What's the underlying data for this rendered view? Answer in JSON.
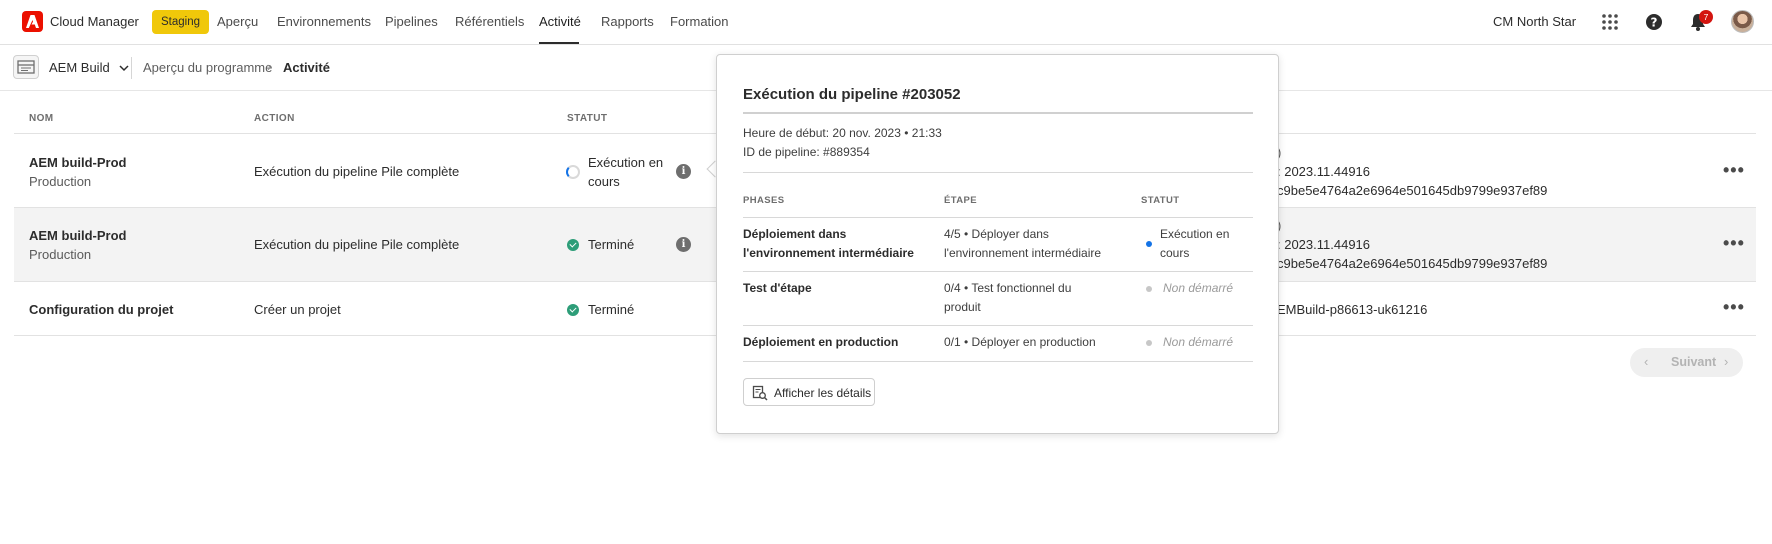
{
  "topnav": {
    "app_title": "Cloud Manager",
    "env_badge": "Staging",
    "items": [
      "Aperçu",
      "Environnements",
      "Pipelines",
      "Référentiels",
      "Activité",
      "Rapports",
      "Formation"
    ],
    "active_index": 4,
    "org_name": "CM North Star",
    "notification_count": "7"
  },
  "subheader": {
    "program_name": "AEM Build",
    "breadcrumb": [
      "Aperçu du programme",
      "Activité"
    ]
  },
  "table": {
    "columns": [
      "NOM",
      "ACTION",
      "STATUT"
    ],
    "rows": [
      {
        "name": "AEM build-Prod",
        "sub": "Production",
        "action": "Exécution du pipeline Pile complète",
        "status_line1": "Exécution en",
        "status_line2": "cours",
        "details_line1": ": 2023.11.44916",
        "details_line2": "c9be5e4764a2e6964e501645db9799e937ef89"
      },
      {
        "name": "AEM build-Prod",
        "sub": "Production",
        "action": "Exécution du pipeline Pile complète",
        "status": "Terminé",
        "details_line1": ": 2023.11.44916",
        "details_line2": "c9be5e4764a2e6964e501645db9799e937ef89"
      },
      {
        "name": "Configuration du projet",
        "action": "Créer un projet",
        "status": "Terminé",
        "details_line1": "EMBuild-p86613-uk61216"
      }
    ],
    "more_icon": "more-horizontal-icon"
  },
  "pager": {
    "next_label": "Suivant"
  },
  "popover": {
    "title": "Exécution du pipeline #203052",
    "start_time": "Heure de début: 20 nov. 2023 • 21:33",
    "pipeline_id": "ID de pipeline: #889354",
    "columns": [
      "PHASES",
      "ÉTAPE",
      "STATUT"
    ],
    "phases": [
      {
        "phase_line1": "Déploiement dans",
        "phase_line2": "l'environnement intermédiaire",
        "step_line1": "4/5 • Déployer dans",
        "step_line2": "l'environnement intermédiaire",
        "status_line1": "Exécution en",
        "status_line2": "cours",
        "dot_color": "#1473e6"
      },
      {
        "phase_line1": "Test d'étape",
        "step_line1": "0/4 • Test fonctionnel du",
        "step_line2": "produit",
        "status_line1": "Non démarré",
        "dot_color": "#c7c7c7"
      },
      {
        "phase_line1": "Déploiement en production",
        "step_line1": "0/1 • Déployer en production",
        "status_line1": "Non démarré",
        "dot_color": "#c7c7c7"
      }
    ],
    "details_button": "Afficher les détails"
  },
  "colors": {
    "brand": "#eb1000",
    "badge": "#f0c80a",
    "success": "#2d9d78",
    "progress": "#1473e6"
  }
}
